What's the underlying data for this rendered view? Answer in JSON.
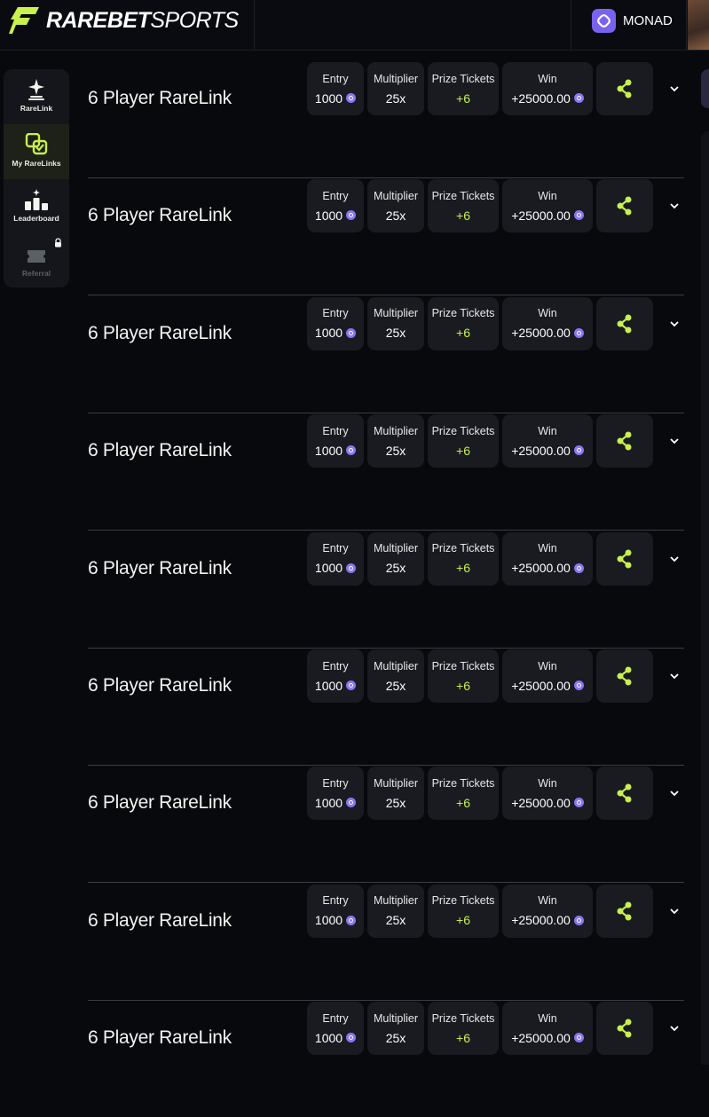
{
  "header": {
    "brand_bold": "RAREBET",
    "brand_light": "SPORTS",
    "network_label": "MONAD",
    "logo_icon": "lightning-mark-icon",
    "network_icon": "monad-icon"
  },
  "sidebar": {
    "items": [
      {
        "label": "RareLink",
        "icon": "sparkle-stack-icon",
        "active": false,
        "locked": false
      },
      {
        "label": "My RareLinks",
        "icon": "link-check-icon",
        "active": true,
        "locked": false
      },
      {
        "label": "Leaderboard",
        "icon": "podium-icon",
        "active": false,
        "locked": false
      },
      {
        "label": "Referral",
        "icon": "ticket-icon",
        "active": false,
        "locked": true
      }
    ]
  },
  "rarelinks": {
    "entry_label": "Entry",
    "multiplier_label": "Multiplier",
    "prize_label": "Prize Tickets",
    "win_label": "Win",
    "items": [
      {
        "title": "6 Player RareLink",
        "entry": "1000",
        "multiplier": "25x",
        "prize_tickets": "+6",
        "win": "+25000.00"
      },
      {
        "title": "6 Player RareLink",
        "entry": "1000",
        "multiplier": "25x",
        "prize_tickets": "+6",
        "win": "+25000.00"
      },
      {
        "title": "6 Player RareLink",
        "entry": "1000",
        "multiplier": "25x",
        "prize_tickets": "+6",
        "win": "+25000.00"
      },
      {
        "title": "6 Player RareLink",
        "entry": "1000",
        "multiplier": "25x",
        "prize_tickets": "+6",
        "win": "+25000.00"
      },
      {
        "title": "6 Player RareLink",
        "entry": "1000",
        "multiplier": "25x",
        "prize_tickets": "+6",
        "win": "+25000.00"
      },
      {
        "title": "6 Player RareLink",
        "entry": "1000",
        "multiplier": "25x",
        "prize_tickets": "+6",
        "win": "+25000.00"
      },
      {
        "title": "6 Player RareLink",
        "entry": "1000",
        "multiplier": "25x",
        "prize_tickets": "+6",
        "win": "+25000.00"
      },
      {
        "title": "6 Player RareLink",
        "entry": "1000",
        "multiplier": "25x",
        "prize_tickets": "+6",
        "win": "+25000.00"
      },
      {
        "title": "6 Player RareLink",
        "entry": "1000",
        "multiplier": "25x",
        "prize_tickets": "+6",
        "win": "+25000.00"
      }
    ]
  },
  "colors": {
    "accent": "#c8f04e",
    "monad": "#7a62f1",
    "background": "#08090d",
    "card": "#191b21"
  }
}
